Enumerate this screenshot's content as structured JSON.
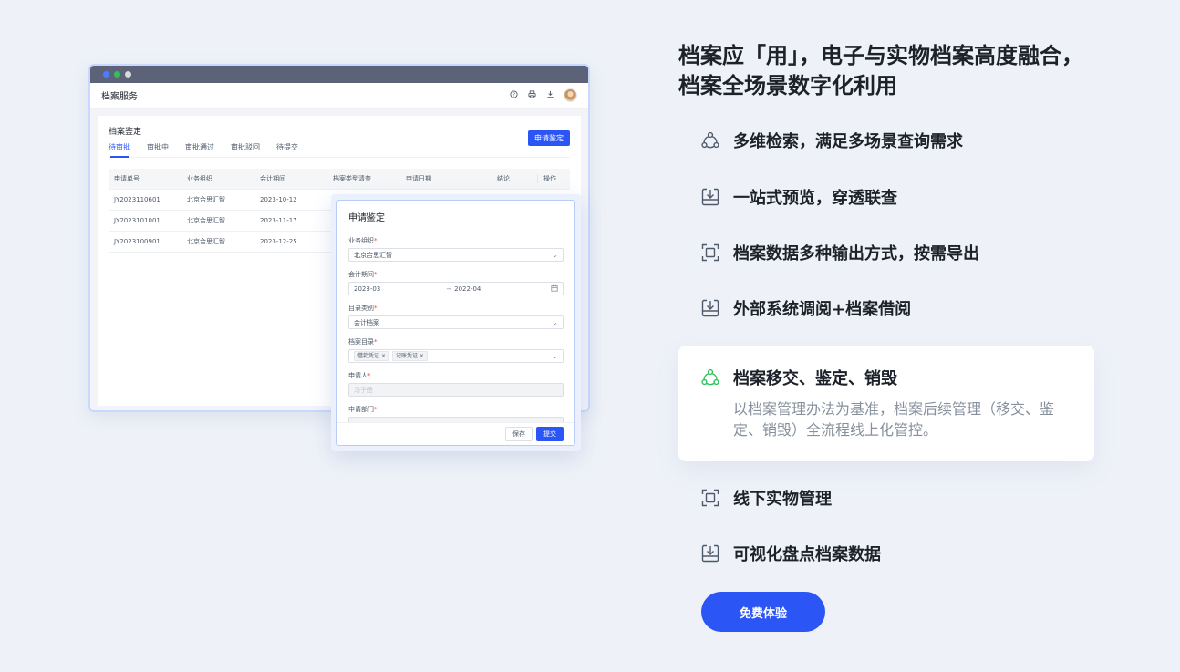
{
  "window": {
    "dots": [
      "#4d7cfe",
      "#2fc25b",
      "#d9d9d9"
    ],
    "app_title": "档案服务",
    "card_title": "档案鉴定",
    "apply_button": "申请鉴定",
    "tabs": [
      "待审批",
      "审批中",
      "审批通过",
      "审批驳回",
      "待提交"
    ],
    "table": {
      "headers": [
        "申请单号",
        "业务组织",
        "会计期间",
        "档案类型清查",
        "申请日期",
        "结论",
        "操作"
      ],
      "rows": [
        [
          "JY2023110601",
          "北京合思汇智",
          "2023-10-12"
        ],
        [
          "JY2023101001",
          "北京合思汇智",
          "2023-11-17"
        ],
        [
          "JY2023100901",
          "北京合思汇智",
          "2023-12-25"
        ]
      ]
    }
  },
  "dialog": {
    "title": "申请鉴定",
    "fields": {
      "org_label": "业务组织",
      "org_value": "北京合思汇智",
      "period_label": "会计期间",
      "period_start": "2023-03",
      "period_end": "2022-04",
      "category_label": "目录类别",
      "category_value": "会计档案",
      "catalog_label": "档案目录",
      "catalog_tags": [
        "借款凭证",
        "记账凭证"
      ],
      "applicant_label": "申请人",
      "applicant_value": "冯子岳",
      "dept_label": "申请部门"
    },
    "save_button": "保存",
    "submit_button": "提交"
  },
  "headline": {
    "line1": "档案应「用」，电子与实物档案高度融合，",
    "line2": "档案全场景数字化利用"
  },
  "features": [
    {
      "label": "多维检索，满足多场景查询需求",
      "icon": "nodes-icon"
    },
    {
      "label": "一站式预览，穿透联查",
      "icon": "tray-download-icon"
    },
    {
      "label": "档案数据多种输出方式，按需导出",
      "icon": "frame-focus-icon"
    },
    {
      "label": "外部系统调阅+档案借阅",
      "icon": "tray-download-icon"
    }
  ],
  "active_feature": {
    "label": "档案移交、鉴定、销毁",
    "icon": "nodes-icon",
    "icon_color": "#2fc25b",
    "description": "以档案管理办法为基准，档案后续管理（移交、鉴定、销毁）全流程线上化管控。"
  },
  "features_after": [
    {
      "label": "线下实物管理",
      "icon": "frame-focus-icon"
    },
    {
      "label": "可视化盘点档案数据",
      "icon": "tray-download-icon"
    }
  ],
  "cta_button": "免费体验",
  "colors": {
    "accent": "#2b55f5",
    "background": "#eef2f8"
  }
}
